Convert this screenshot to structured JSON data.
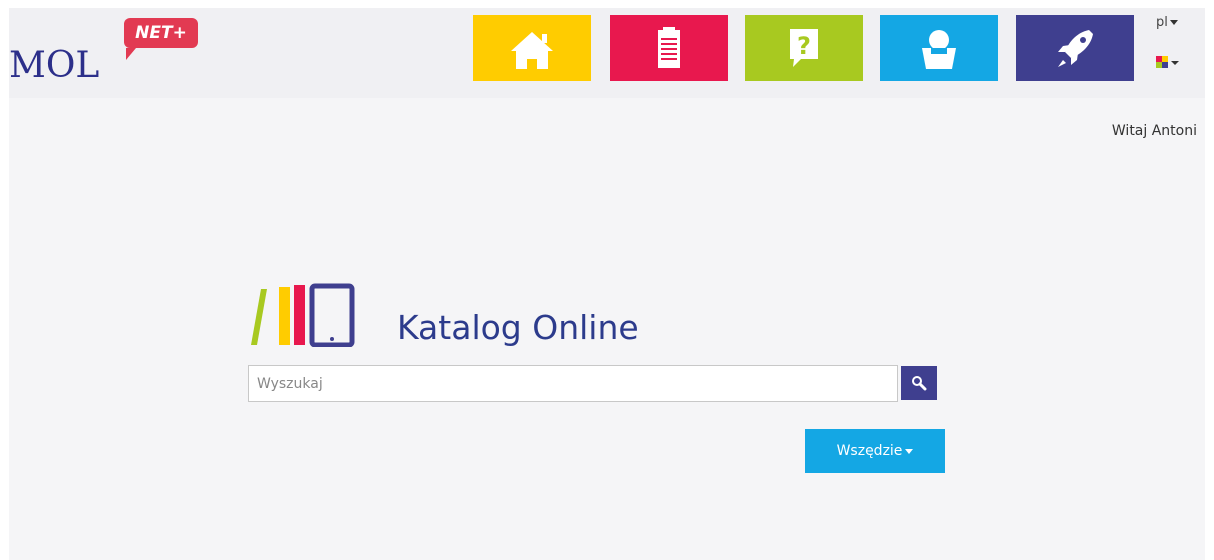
{
  "header": {
    "logo_text": "MOL",
    "logo_badge": "NET+",
    "nav_tiles": [
      {
        "name": "home",
        "icon": "home-icon",
        "color": "#ffcc00"
      },
      {
        "name": "catalog",
        "icon": "clipboard-icon",
        "color": "#e8184e"
      },
      {
        "name": "help",
        "icon": "question-bubble-icon",
        "color": "#a8c920"
      },
      {
        "name": "account",
        "icon": "user-icon",
        "color": "#14a7e4"
      },
      {
        "name": "new",
        "icon": "rocket-icon",
        "color": "#3f3f8f"
      }
    ],
    "language": "pl",
    "color_scheme_icon": "color-palette-icon"
  },
  "greeting": "Witaj Antoni",
  "main": {
    "title": "Katalog Online",
    "search": {
      "placeholder": "Wyszukaj",
      "value": ""
    },
    "scope_button": "Wszędzie"
  },
  "colors": {
    "brand": "#2c2f8a",
    "badge": "#e23a52",
    "accent_blue": "#14a7e4",
    "search_button": "#3f3f8f"
  }
}
